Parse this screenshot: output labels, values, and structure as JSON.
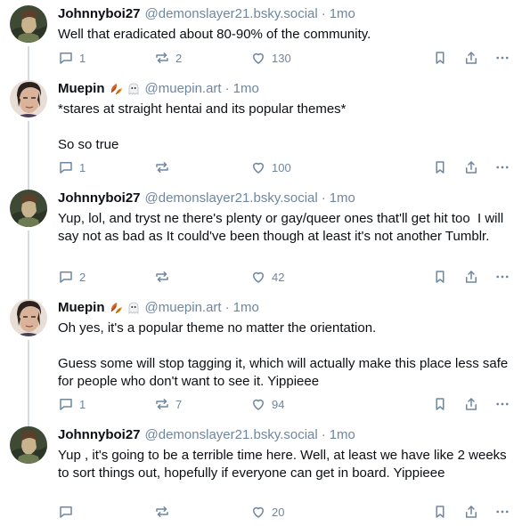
{
  "posts": [
    {
      "author": "Johnnyboi27",
      "handle": "@demonslayer21.bsky.social",
      "time": "1mo",
      "avatar": "avatar-johnnyboi",
      "emojis": [],
      "text": "Well that eradicated about 80-90% of the community.",
      "replies": "1",
      "reposts": "2",
      "likes": "130"
    },
    {
      "author": "Muepin",
      "handle": "@muepin.art",
      "time": "1mo",
      "avatar": "avatar-muepin",
      "emojis": [
        "fallen-leaves-emoji",
        "ghost-emoji"
      ],
      "text": "*stares at straight hentai and its popular themes*\n\nSo so true",
      "replies": "1",
      "reposts": "",
      "likes": "100"
    },
    {
      "author": "Johnnyboi27",
      "handle": "@demonslayer21.bsky.social",
      "time": "1mo",
      "avatar": "avatar-johnnyboi",
      "emojis": [],
      "text": "Yup, lol, and tryst ne there's plenty or gay/queer ones that'll get hit too  I will say not as bad as It could've been though at least it's not another Tumblr.",
      "replies": "2",
      "reposts": "",
      "likes": "42"
    },
    {
      "author": "Muepin",
      "handle": "@muepin.art",
      "time": "1mo",
      "avatar": "avatar-muepin",
      "emojis": [
        "fallen-leaves-emoji",
        "ghost-emoji"
      ],
      "text": "Oh yes, it's a popular theme no matter the orientation.\n\nGuess some will stop tagging it, which will actually make this place less safe for people who don't want to see it. Yippieee",
      "replies": "1",
      "reposts": "7",
      "likes": "94"
    },
    {
      "author": "Johnnyboi27",
      "handle": "@demonslayer21.bsky.social",
      "time": "1mo",
      "avatar": "avatar-johnnyboi",
      "emojis": [],
      "text": "Yup , it's going to be a terrible time here. Well, at least we have like 2 weeks to sort things out, hopefully if everyone can get in board. Yippieee",
      "replies": "",
      "reposts": "",
      "likes": "20"
    }
  ],
  "separator": "·",
  "icons": {
    "reply": "reply-icon",
    "repost": "repost-icon",
    "like": "heart-icon",
    "bookmark": "bookmark-icon",
    "share": "share-icon",
    "more": "more-icon"
  },
  "colors": {
    "text": "#0b0f14",
    "muted": "#6f869f",
    "thread_line": "#d4dbe2"
  }
}
